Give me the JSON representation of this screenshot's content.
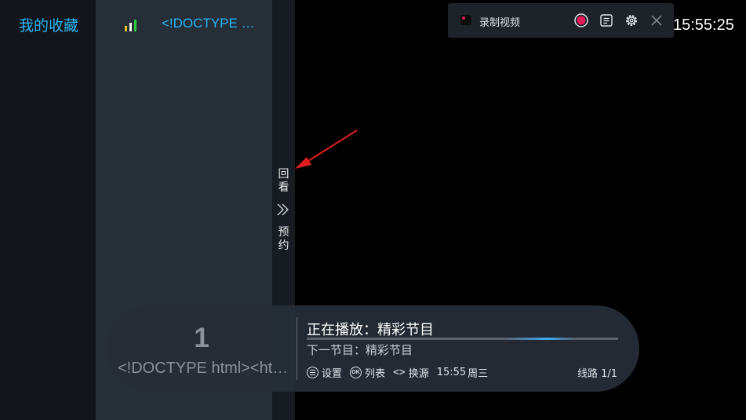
{
  "sidebar": {
    "category_title": "我的收藏"
  },
  "channel_list": {
    "signal_icon": "signal-bars-icon",
    "channel_name": "<!DOCTYPE html><html><head>"
  },
  "side_menu": {
    "replay": "回看",
    "booking": "预约",
    "arrow_icon": "double-chevron-right-icon"
  },
  "recorder": {
    "title": "录制视频",
    "record_color": "#e6195a"
  },
  "clock": {
    "time": "15:55:25"
  },
  "infobar": {
    "channel_number": "1",
    "channel_full_name": "<!DOCTYPE html><html><head>",
    "now_playing": "正在播放：精彩节目",
    "next_program": "下一节目：精彩节目",
    "progress_fraction": 0.86,
    "controls": {
      "settings": "设置",
      "ok_badge": "OK",
      "list": "列表",
      "switch_source": "换源",
      "time": "15:55",
      "weekday": "周三"
    },
    "line_info": "线路 1/1"
  },
  "colors": {
    "accent": "#29b6f6",
    "annotation_arrow": "#e01e1e"
  }
}
